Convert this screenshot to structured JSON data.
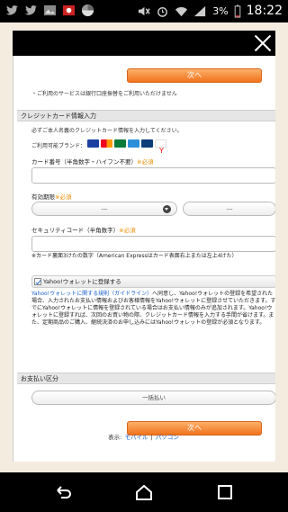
{
  "status_bar": {
    "left_icons": [
      "twitter-icon",
      "twitter-icon",
      "image-icon",
      "photo-icon",
      "pinwheel-icon"
    ],
    "right_icons": [
      "mute-icon",
      "alarm-icon",
      "wifi-icon",
      "signal-icon",
      "battery-icon"
    ],
    "battery_percent": "3%",
    "time": "18:22"
  },
  "modal": {
    "close_icon": "close-icon"
  },
  "top": {
    "next_label": "次へ",
    "bank_note": "・ご利用のサービスは銀行口座振替をご利用いただけません"
  },
  "credit_card": {
    "section_title": "クレジットカード情報入力",
    "instruction": "必ずご本人名義のクレジットカード情報を入力してください。",
    "brands_label": "ご利用可能ブランド：",
    "card_number_label": "カード番号（半角数字・ハイフン不要）",
    "required": "※必須",
    "expiry_label": "有効期限",
    "expiry_month_value": "---",
    "expiry_year_value": "---",
    "security_label": "セキュリティコード（半角数字）",
    "security_note": "※カード裏面3けたの数字（American Expressはカード表面右上または左上4けた）"
  },
  "wallet": {
    "checkbox_label": "Yahoo!ウォレットに登録する",
    "link_text": "Yahoo!ウォレットに関する規則（ガイドライン）",
    "paragraph": "へ同意し、Yahoo!ウォレットの登録を希望された場合、入力されたお支払い情報およびお客様情報をYahoo!ウォレットに登録させていただきます。すでにYahoo!ウォレットに情報を登録されている場合はお支払い情報のみが追加されます。Yahoo!ウォレットに登録すれば、次回のお買い物の際、クレジットカード情報を入力する手間が省けます。また、定期商品のご購入、継続決済のお申し込みにはYahoo!ウォレットの登録が必須となります。"
  },
  "payment": {
    "section_title": "お支払い区分",
    "value": "一括払い",
    "next_label": "次へ"
  },
  "footer": {
    "display_label": "表示:",
    "mobile": "モバイル",
    "separator": "|",
    "pc": "パソコン"
  },
  "nav": {
    "back_icon": "back-icon",
    "home_icon": "home-icon",
    "recent_icon": "recent-apps-icon"
  }
}
